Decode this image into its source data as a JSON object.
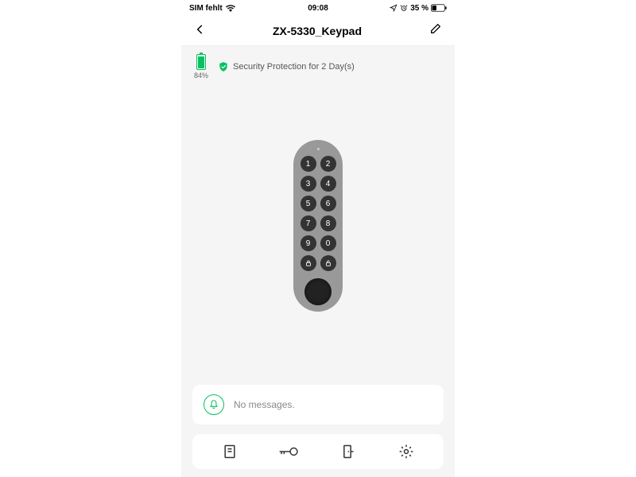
{
  "statusBar": {
    "simText": "SIM fehlt",
    "time": "09:08",
    "batteryPct": "35 %"
  },
  "nav": {
    "title": "ZX-5330_Keypad"
  },
  "battery": {
    "pct": "84%",
    "fillHeight": "84%"
  },
  "security": {
    "text": "Security Protection for 2 Day(s)"
  },
  "keypad": {
    "rows": [
      [
        "1",
        "2"
      ],
      [
        "3",
        "4"
      ],
      [
        "5",
        "6"
      ],
      [
        "7",
        "8"
      ],
      [
        "9",
        "0"
      ]
    ]
  },
  "messages": {
    "text": "No messages."
  }
}
